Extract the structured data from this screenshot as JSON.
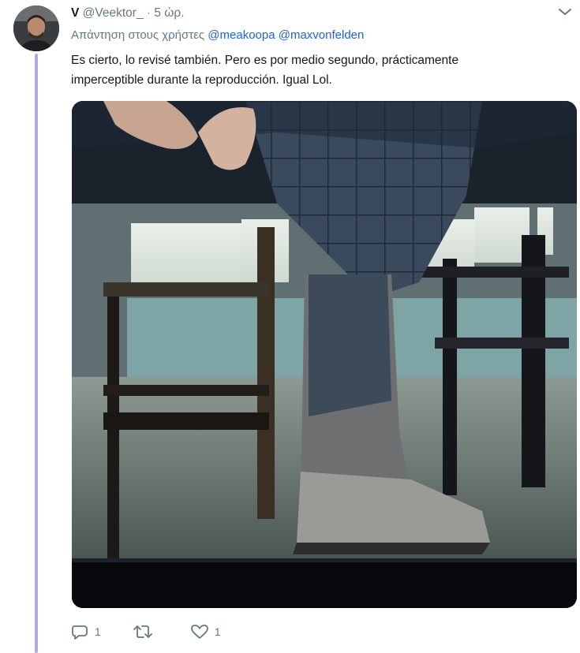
{
  "tweet": {
    "display_name": "V",
    "handle": "@Veektor_",
    "separator": "·",
    "time": "5 ώρ.",
    "reply_prefix": "Απάντηση στους χρήστες",
    "mentions": [
      "@meakoopa",
      "@maxvonfelden"
    ],
    "text_line1": "Es cierto, lo revisé también. Pero es por medio segundo, prácticamente",
    "text_line2": "imperceptible durante la reproducción. Igual Lol.",
    "media_description_icon": "photo",
    "actions": {
      "reply_count": "1",
      "retweet_count": "",
      "like_count": "1"
    }
  },
  "icons": {
    "menu": "chevron-down-icon",
    "reply": "speech-bubble-icon",
    "retweet": "retweet-icon",
    "like": "heart-icon"
  },
  "colors": {
    "thread_line": "#b8a6e0",
    "link": "#1b64d6",
    "secondary_text": "#657786"
  }
}
